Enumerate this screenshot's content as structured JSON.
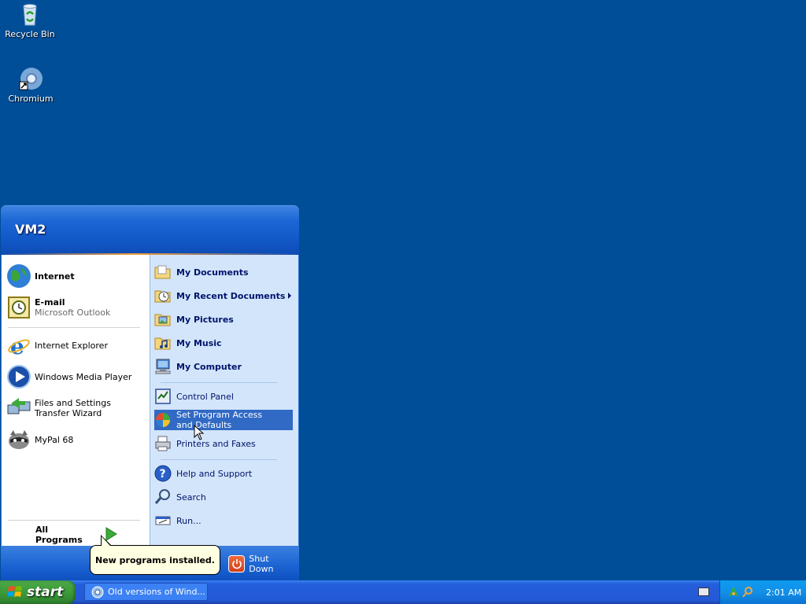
{
  "desktop": {
    "icons": [
      {
        "label": "Recycle Bin",
        "icon": "recycle-bin-icon"
      },
      {
        "label": "Chromium",
        "icon": "chromium-icon"
      }
    ]
  },
  "start_menu": {
    "user_name": "VM2",
    "pinned": [
      {
        "label": "Internet",
        "icon": "internet-globe-icon"
      },
      {
        "label": "E-mail",
        "sub": "Microsoft Outlook",
        "icon": "outlook-icon"
      }
    ],
    "recent": [
      {
        "label": "Internet Explorer",
        "icon": "internet-explorer-icon"
      },
      {
        "label": "Windows Media Player",
        "icon": "media-player-icon"
      },
      {
        "label": "Files and Settings Transfer Wizard",
        "icon": "transfer-wizard-icon"
      },
      {
        "label": "MyPal 68",
        "icon": "mypal-icon"
      }
    ],
    "all_programs_label": "All Programs",
    "places": [
      {
        "label": "My Documents"
      },
      {
        "label": "My Recent Documents"
      },
      {
        "label": "My Pictures"
      },
      {
        "label": "My Music"
      },
      {
        "label": "My Computer"
      }
    ],
    "system": [
      {
        "label": "Control Panel"
      },
      {
        "label": "Set Program Access and Defaults"
      },
      {
        "label": "Printers and Faxes"
      }
    ],
    "help": [
      {
        "label": "Help and Support"
      },
      {
        "label": "Search"
      },
      {
        "label": "Run..."
      }
    ],
    "shutdown_label": "Shut Down"
  },
  "balloon": {
    "text": "New programs installed."
  },
  "taskbar": {
    "start_label": "start",
    "task_button_label": "Old versions of Wind...",
    "clock": "2:01 AM"
  },
  "colors": {
    "desktop": "#004e98",
    "highlight": "#316ac5",
    "taskbar": "#245edb",
    "start_button": "#3c9b3a"
  }
}
